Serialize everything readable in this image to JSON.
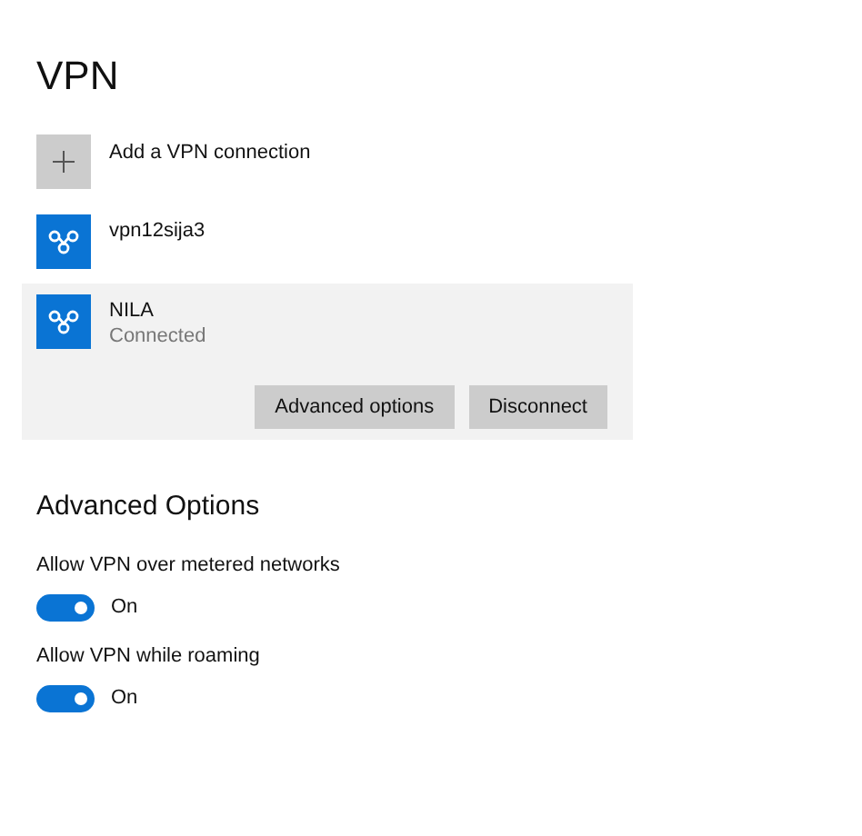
{
  "title": "VPN",
  "add_connection": {
    "label": "Add a VPN connection"
  },
  "connections": [
    {
      "name": "vpn12sija3",
      "selected": false
    },
    {
      "name": "NILA",
      "status": "Connected",
      "selected": true,
      "buttons": [
        "Advanced options",
        "Disconnect"
      ]
    }
  ],
  "advanced": {
    "heading": "Advanced Options",
    "options": [
      {
        "label": "Allow VPN over metered networks",
        "on": true,
        "state_label": "On"
      },
      {
        "label": "Allow VPN while roaming",
        "on": true,
        "state_label": "On"
      }
    ]
  }
}
